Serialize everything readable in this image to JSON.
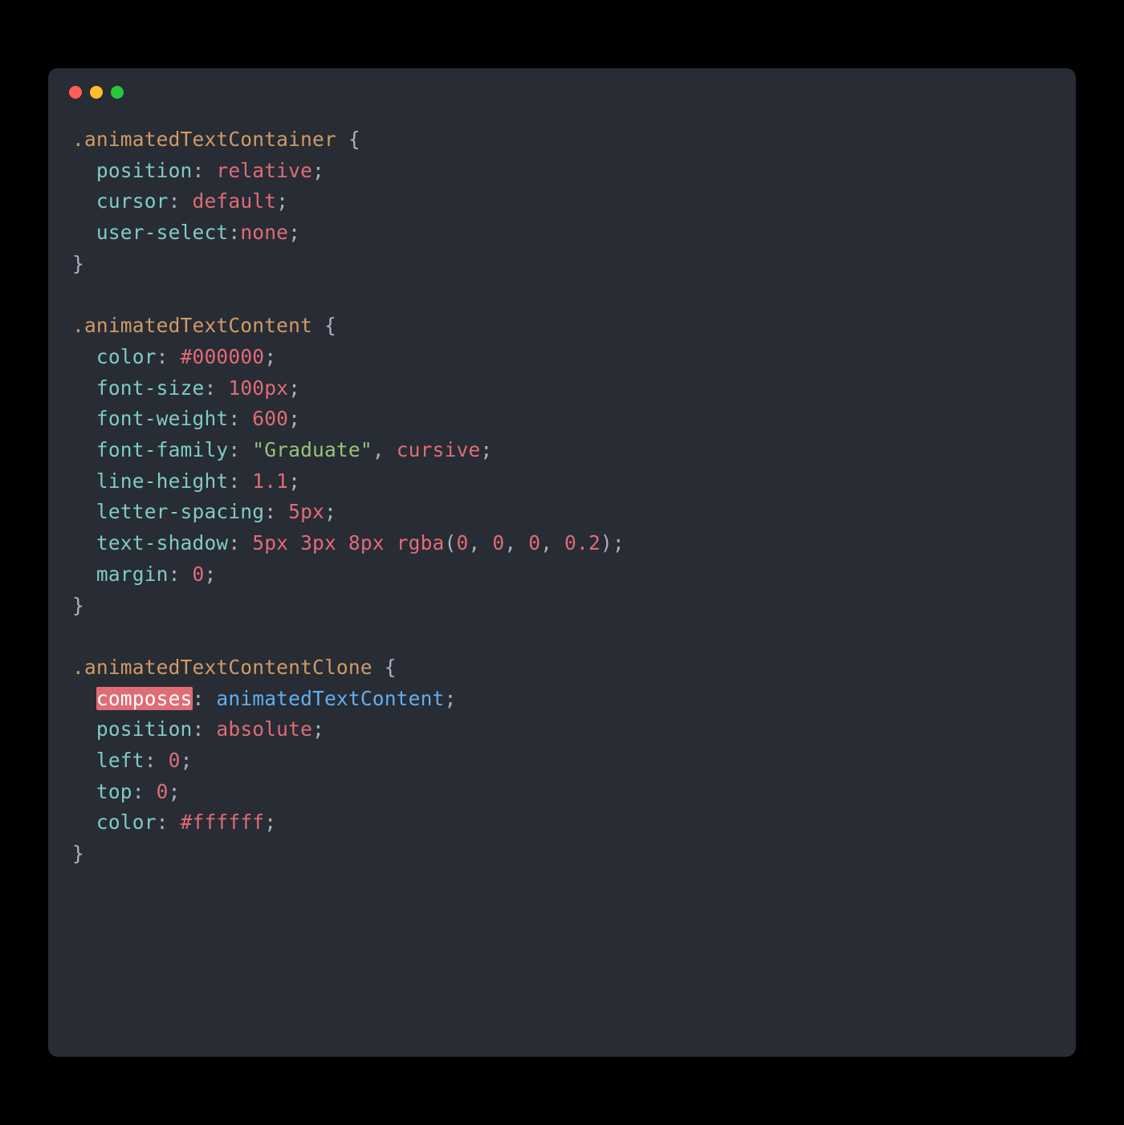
{
  "window": {
    "traffic_lights": [
      "red",
      "yellow",
      "green"
    ]
  },
  "code": {
    "rules": [
      {
        "selector": ".animatedTextContainer",
        "declarations": [
          {
            "prop": "position",
            "value": [
              {
                "t": "kw",
                "v": "relative"
              }
            ],
            "space_after_colon": true
          },
          {
            "prop": "cursor",
            "value": [
              {
                "t": "kw",
                "v": "default"
              }
            ],
            "space_after_colon": true
          },
          {
            "prop": "user-select",
            "value": [
              {
                "t": "kw",
                "v": "none"
              }
            ],
            "space_after_colon": false
          }
        ]
      },
      {
        "selector": ".animatedTextContent",
        "declarations": [
          {
            "prop": "color",
            "value": [
              {
                "t": "color",
                "v": "#000000"
              }
            ],
            "space_after_colon": true
          },
          {
            "prop": "font-size",
            "value": [
              {
                "t": "num",
                "v": "100px"
              }
            ],
            "space_after_colon": true
          },
          {
            "prop": "font-weight",
            "value": [
              {
                "t": "num",
                "v": "600"
              }
            ],
            "space_after_colon": true
          },
          {
            "prop": "font-family",
            "value": [
              {
                "t": "str",
                "v": "\"Graduate\""
              },
              {
                "t": "punct",
                "v": ", "
              },
              {
                "t": "kw",
                "v": "cursive"
              }
            ],
            "space_after_colon": true
          },
          {
            "prop": "line-height",
            "value": [
              {
                "t": "num",
                "v": "1.1"
              }
            ],
            "space_after_colon": true
          },
          {
            "prop": "letter-spacing",
            "value": [
              {
                "t": "num",
                "v": "5px"
              }
            ],
            "space_after_colon": true
          },
          {
            "prop": "text-shadow",
            "value": [
              {
                "t": "num",
                "v": "5px"
              },
              {
                "t": "sp",
                "v": " "
              },
              {
                "t": "num",
                "v": "3px"
              },
              {
                "t": "sp",
                "v": " "
              },
              {
                "t": "num",
                "v": "8px"
              },
              {
                "t": "sp",
                "v": " "
              },
              {
                "t": "func",
                "v": "rgba"
              },
              {
                "t": "paren",
                "v": "("
              },
              {
                "t": "num",
                "v": "0"
              },
              {
                "t": "punct",
                "v": ", "
              },
              {
                "t": "num",
                "v": "0"
              },
              {
                "t": "punct",
                "v": ", "
              },
              {
                "t": "num",
                "v": "0"
              },
              {
                "t": "punct",
                "v": ", "
              },
              {
                "t": "num",
                "v": "0.2"
              },
              {
                "t": "paren",
                "v": ")"
              }
            ],
            "space_after_colon": true
          },
          {
            "prop": "margin",
            "value": [
              {
                "t": "num",
                "v": "0"
              }
            ],
            "space_after_colon": true
          }
        ]
      },
      {
        "selector": ".animatedTextContentClone",
        "declarations": [
          {
            "prop": "composes",
            "prop_highlight": true,
            "value": [
              {
                "t": "ident",
                "v": "animatedTextContent"
              }
            ],
            "space_after_colon": true
          },
          {
            "prop": "position",
            "value": [
              {
                "t": "kw",
                "v": "absolute"
              }
            ],
            "space_after_colon": true
          },
          {
            "prop": "left",
            "value": [
              {
                "t": "num",
                "v": "0"
              }
            ],
            "space_after_colon": true
          },
          {
            "prop": "top",
            "value": [
              {
                "t": "num",
                "v": "0"
              }
            ],
            "space_after_colon": true
          },
          {
            "prop": "color",
            "value": [
              {
                "t": "color",
                "v": "#ffffff"
              }
            ],
            "space_after_colon": true
          }
        ]
      }
    ]
  },
  "colors": {
    "bg": "#000000",
    "window_bg": "#282c34",
    "selector": "#d19a66",
    "property": "#80cbc4",
    "value_keyword": "#e06c75",
    "string": "#98c379",
    "identifier": "#61afef",
    "default_text": "#abb2bf",
    "highlight_bg": "#e06c75",
    "highlight_fg": "#ffffff"
  }
}
